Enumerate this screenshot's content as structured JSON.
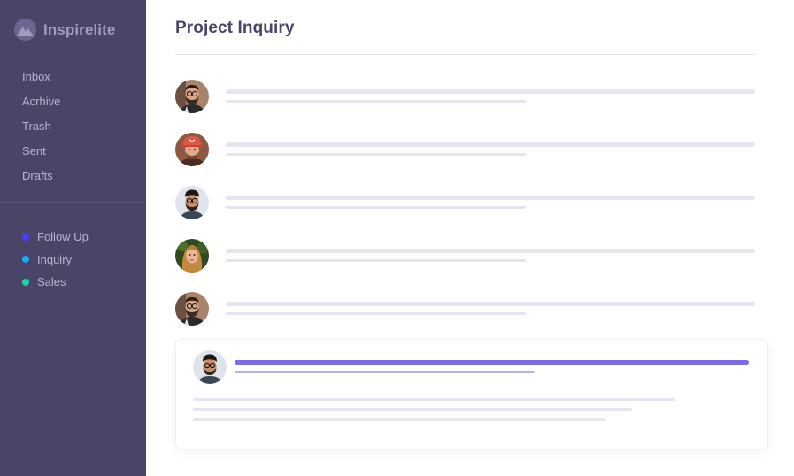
{
  "brand": {
    "name": "Inspirelite",
    "logo_icon": "mountain-logo-icon"
  },
  "sidebar": {
    "nav_items": [
      {
        "label": "Inbox"
      },
      {
        "label": "Acrhive"
      },
      {
        "label": "Trash"
      },
      {
        "label": "Sent"
      },
      {
        "label": "Drafts"
      }
    ],
    "labels": [
      {
        "label": "Follow Up",
        "color": "#4a3ff0"
      },
      {
        "label": "Inquiry",
        "color": "#1ea7f7"
      },
      {
        "label": "Sales",
        "color": "#14d6a0"
      }
    ]
  },
  "main": {
    "title": "Project Inquiry",
    "messages": [
      {
        "avatar_icon": "man-glasses-beard-avatar"
      },
      {
        "avatar_icon": "man-red-cap-avatar"
      },
      {
        "avatar_icon": "man-glasses-avatar"
      },
      {
        "avatar_icon": "woman-avatar"
      },
      {
        "avatar_icon": "man-glasses-beard-avatar"
      }
    ],
    "open_message": {
      "avatar_icon": "man-glasses-avatar"
    }
  },
  "colors": {
    "sidebar_bg": "#4a4566",
    "accent": "#7b6be6",
    "placeholder": "#e5e4ef"
  }
}
